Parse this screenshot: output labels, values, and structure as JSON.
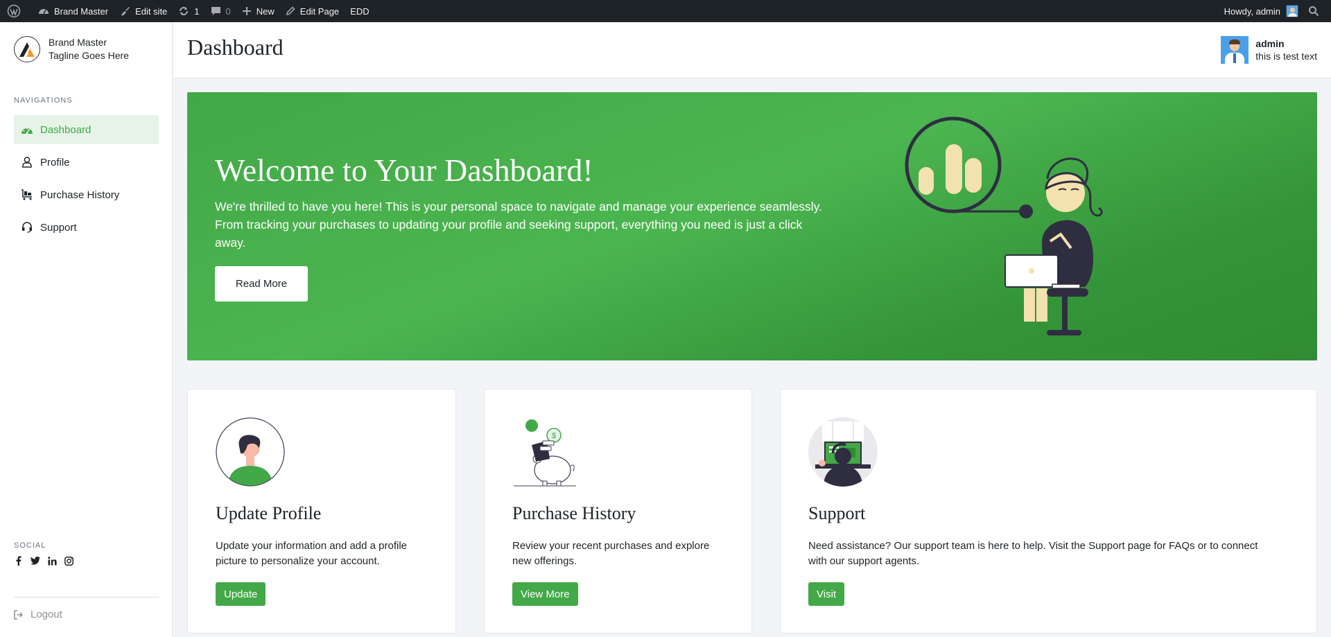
{
  "adminbar": {
    "site_name": "Brand Master",
    "edit_site": "Edit site",
    "updates_count": "1",
    "comments_count": "0",
    "new_label": "New",
    "edit_page": "Edit Page",
    "edd": "EDD",
    "howdy": "Howdy, admin"
  },
  "sidebar": {
    "brand_name": "Brand Master",
    "brand_tagline": "Tagline Goes Here",
    "nav_heading": "NAVIGATIONS",
    "items": [
      {
        "label": "Dashboard",
        "icon": "dashboard-icon",
        "active": true
      },
      {
        "label": "Profile",
        "icon": "user-icon",
        "active": false
      },
      {
        "label": "Purchase History",
        "icon": "cart-icon",
        "active": false
      },
      {
        "label": "Support",
        "icon": "headset-icon",
        "active": false
      }
    ],
    "social_heading": "SOCIAL",
    "social": [
      "facebook-icon",
      "twitter-icon",
      "linkedin-icon",
      "instagram-icon"
    ],
    "logout": "Logout"
  },
  "header": {
    "title": "Dashboard",
    "user_name": "admin",
    "user_sub": "this is test text"
  },
  "hero": {
    "title": "Welcome to Your Dashboard!",
    "text": "We're thrilled to have you here! This is your personal space to navigate and manage your experience seamlessly. From tracking your purchases to updating your profile and seeking support, everything you need is just a click away.",
    "button": "Read More"
  },
  "cards": [
    {
      "title": "Update Profile",
      "text_1": "Update your information and add a profile",
      "text_2": "picture to personalize your account.",
      "button": "Update"
    },
    {
      "title": "Purchase History",
      "text_1": "Review your recent purchases and explore",
      "text_2": "new offerings.",
      "button": "View More"
    },
    {
      "title": "Support",
      "text_1": "Need assistance? Our support team is here to help. Visit the Support page for FAQs or to connect",
      "text_2": "with our support agents.",
      "button": "Visit"
    }
  ],
  "colors": {
    "accent": "#43a847",
    "adminbar": "#1d2327",
    "page_bg": "#f2f4f7"
  }
}
